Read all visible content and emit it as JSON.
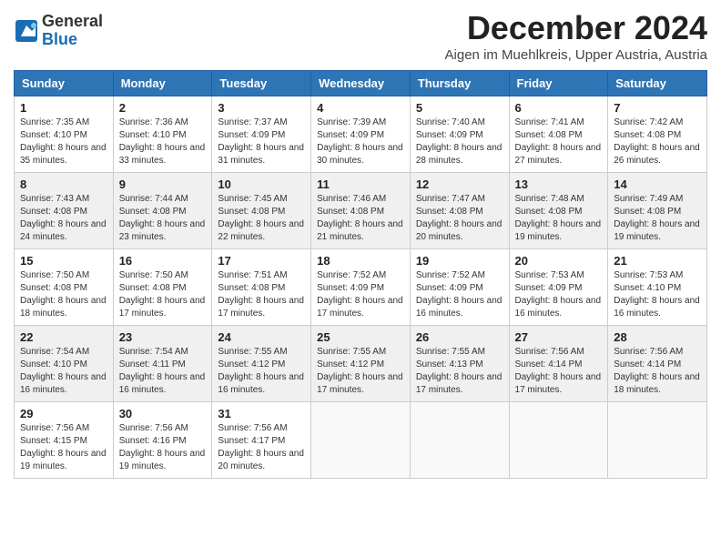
{
  "logo": {
    "general": "General",
    "blue": "Blue"
  },
  "title": "December 2024",
  "subtitle": "Aigen im Muehlkreis, Upper Austria, Austria",
  "days_header": [
    "Sunday",
    "Monday",
    "Tuesday",
    "Wednesday",
    "Thursday",
    "Friday",
    "Saturday"
  ],
  "weeks": [
    [
      {
        "day": "1",
        "sunrise": "Sunrise: 7:35 AM",
        "sunset": "Sunset: 4:10 PM",
        "daylight": "Daylight: 8 hours and 35 minutes."
      },
      {
        "day": "2",
        "sunrise": "Sunrise: 7:36 AM",
        "sunset": "Sunset: 4:10 PM",
        "daylight": "Daylight: 8 hours and 33 minutes."
      },
      {
        "day": "3",
        "sunrise": "Sunrise: 7:37 AM",
        "sunset": "Sunset: 4:09 PM",
        "daylight": "Daylight: 8 hours and 31 minutes."
      },
      {
        "day": "4",
        "sunrise": "Sunrise: 7:39 AM",
        "sunset": "Sunset: 4:09 PM",
        "daylight": "Daylight: 8 hours and 30 minutes."
      },
      {
        "day": "5",
        "sunrise": "Sunrise: 7:40 AM",
        "sunset": "Sunset: 4:09 PM",
        "daylight": "Daylight: 8 hours and 28 minutes."
      },
      {
        "day": "6",
        "sunrise": "Sunrise: 7:41 AM",
        "sunset": "Sunset: 4:08 PM",
        "daylight": "Daylight: 8 hours and 27 minutes."
      },
      {
        "day": "7",
        "sunrise": "Sunrise: 7:42 AM",
        "sunset": "Sunset: 4:08 PM",
        "daylight": "Daylight: 8 hours and 26 minutes."
      }
    ],
    [
      {
        "day": "8",
        "sunrise": "Sunrise: 7:43 AM",
        "sunset": "Sunset: 4:08 PM",
        "daylight": "Daylight: 8 hours and 24 minutes."
      },
      {
        "day": "9",
        "sunrise": "Sunrise: 7:44 AM",
        "sunset": "Sunset: 4:08 PM",
        "daylight": "Daylight: 8 hours and 23 minutes."
      },
      {
        "day": "10",
        "sunrise": "Sunrise: 7:45 AM",
        "sunset": "Sunset: 4:08 PM",
        "daylight": "Daylight: 8 hours and 22 minutes."
      },
      {
        "day": "11",
        "sunrise": "Sunrise: 7:46 AM",
        "sunset": "Sunset: 4:08 PM",
        "daylight": "Daylight: 8 hours and 21 minutes."
      },
      {
        "day": "12",
        "sunrise": "Sunrise: 7:47 AM",
        "sunset": "Sunset: 4:08 PM",
        "daylight": "Daylight: 8 hours and 20 minutes."
      },
      {
        "day": "13",
        "sunrise": "Sunrise: 7:48 AM",
        "sunset": "Sunset: 4:08 PM",
        "daylight": "Daylight: 8 hours and 19 minutes."
      },
      {
        "day": "14",
        "sunrise": "Sunrise: 7:49 AM",
        "sunset": "Sunset: 4:08 PM",
        "daylight": "Daylight: 8 hours and 19 minutes."
      }
    ],
    [
      {
        "day": "15",
        "sunrise": "Sunrise: 7:50 AM",
        "sunset": "Sunset: 4:08 PM",
        "daylight": "Daylight: 8 hours and 18 minutes."
      },
      {
        "day": "16",
        "sunrise": "Sunrise: 7:50 AM",
        "sunset": "Sunset: 4:08 PM",
        "daylight": "Daylight: 8 hours and 17 minutes."
      },
      {
        "day": "17",
        "sunrise": "Sunrise: 7:51 AM",
        "sunset": "Sunset: 4:08 PM",
        "daylight": "Daylight: 8 hours and 17 minutes."
      },
      {
        "day": "18",
        "sunrise": "Sunrise: 7:52 AM",
        "sunset": "Sunset: 4:09 PM",
        "daylight": "Daylight: 8 hours and 17 minutes."
      },
      {
        "day": "19",
        "sunrise": "Sunrise: 7:52 AM",
        "sunset": "Sunset: 4:09 PM",
        "daylight": "Daylight: 8 hours and 16 minutes."
      },
      {
        "day": "20",
        "sunrise": "Sunrise: 7:53 AM",
        "sunset": "Sunset: 4:09 PM",
        "daylight": "Daylight: 8 hours and 16 minutes."
      },
      {
        "day": "21",
        "sunrise": "Sunrise: 7:53 AM",
        "sunset": "Sunset: 4:10 PM",
        "daylight": "Daylight: 8 hours and 16 minutes."
      }
    ],
    [
      {
        "day": "22",
        "sunrise": "Sunrise: 7:54 AM",
        "sunset": "Sunset: 4:10 PM",
        "daylight": "Daylight: 8 hours and 16 minutes."
      },
      {
        "day": "23",
        "sunrise": "Sunrise: 7:54 AM",
        "sunset": "Sunset: 4:11 PM",
        "daylight": "Daylight: 8 hours and 16 minutes."
      },
      {
        "day": "24",
        "sunrise": "Sunrise: 7:55 AM",
        "sunset": "Sunset: 4:12 PM",
        "daylight": "Daylight: 8 hours and 16 minutes."
      },
      {
        "day": "25",
        "sunrise": "Sunrise: 7:55 AM",
        "sunset": "Sunset: 4:12 PM",
        "daylight": "Daylight: 8 hours and 17 minutes."
      },
      {
        "day": "26",
        "sunrise": "Sunrise: 7:55 AM",
        "sunset": "Sunset: 4:13 PM",
        "daylight": "Daylight: 8 hours and 17 minutes."
      },
      {
        "day": "27",
        "sunrise": "Sunrise: 7:56 AM",
        "sunset": "Sunset: 4:14 PM",
        "daylight": "Daylight: 8 hours and 17 minutes."
      },
      {
        "day": "28",
        "sunrise": "Sunrise: 7:56 AM",
        "sunset": "Sunset: 4:14 PM",
        "daylight": "Daylight: 8 hours and 18 minutes."
      }
    ],
    [
      {
        "day": "29",
        "sunrise": "Sunrise: 7:56 AM",
        "sunset": "Sunset: 4:15 PM",
        "daylight": "Daylight: 8 hours and 19 minutes."
      },
      {
        "day": "30",
        "sunrise": "Sunrise: 7:56 AM",
        "sunset": "Sunset: 4:16 PM",
        "daylight": "Daylight: 8 hours and 19 minutes."
      },
      {
        "day": "31",
        "sunrise": "Sunrise: 7:56 AM",
        "sunset": "Sunset: 4:17 PM",
        "daylight": "Daylight: 8 hours and 20 minutes."
      },
      null,
      null,
      null,
      null
    ]
  ]
}
